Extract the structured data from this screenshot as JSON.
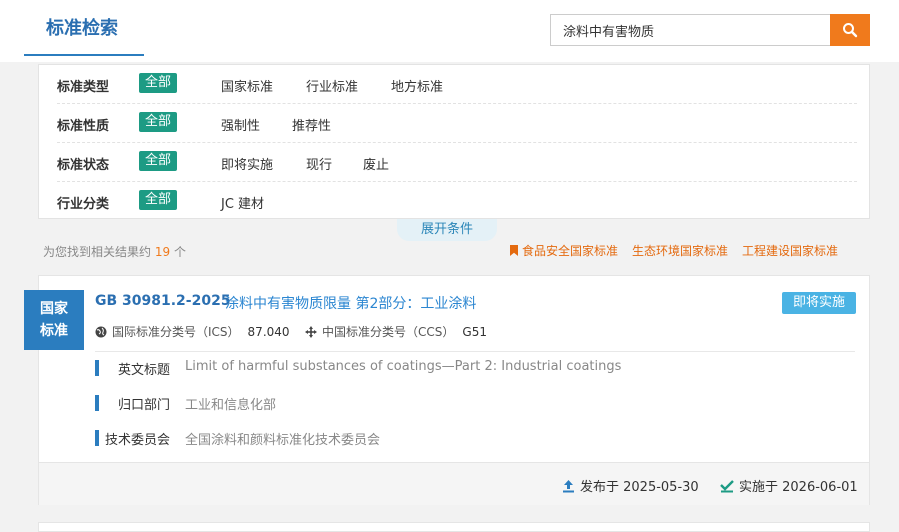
{
  "header": {
    "title": "标准检索"
  },
  "search": {
    "value": "涂料中有害物质"
  },
  "filters": [
    {
      "label": "标准类型",
      "all": "全部",
      "options": [
        "国家标准",
        "行业标准",
        "地方标准"
      ]
    },
    {
      "label": "标准性质",
      "all": "全部",
      "options": [
        "强制性",
        "推荐性"
      ]
    },
    {
      "label": "标准状态",
      "all": "全部",
      "options": [
        "即将实施",
        "现行",
        "废止"
      ]
    },
    {
      "label": "行业分类",
      "all": "全部",
      "options": [
        "JC 建材"
      ]
    }
  ],
  "expand_label": "展开条件",
  "summary": {
    "prefix": "为您找到相关结果约",
    "count": "19",
    "suffix": "个"
  },
  "std_links": [
    "食品安全国家标准",
    "生态环境国家标准",
    "工程建设国家标准"
  ],
  "result": {
    "badge_line1": "国家",
    "badge_line2": "标准",
    "number": "GB 30981.2-2025",
    "title": "涂料中有害物质限量 第2部分：工业涂料",
    "status": "即将实施",
    "ics_label": "国际标准分类号（ICS）",
    "ics_code": "87.040",
    "ccs_label": "中国标准分类号（CCS）",
    "ccs_code": "G51",
    "details": [
      {
        "key": "英文标题",
        "value": "Limit of harmful substances of coatings—Part 2: Industrial coatings"
      },
      {
        "key": "归口部门",
        "value": "工业和信息化部"
      },
      {
        "key": "技术委员会",
        "value": "全国涂料和颜料标准化技术委员会"
      }
    ],
    "published": "发布于 2025-05-30",
    "implemented": "实施于 2026-06-01"
  },
  "colors": {
    "primary": "#2b7dbf",
    "accent": "#f07a1c",
    "chip": "#1d9b84",
    "status": "#4ab3e4"
  }
}
